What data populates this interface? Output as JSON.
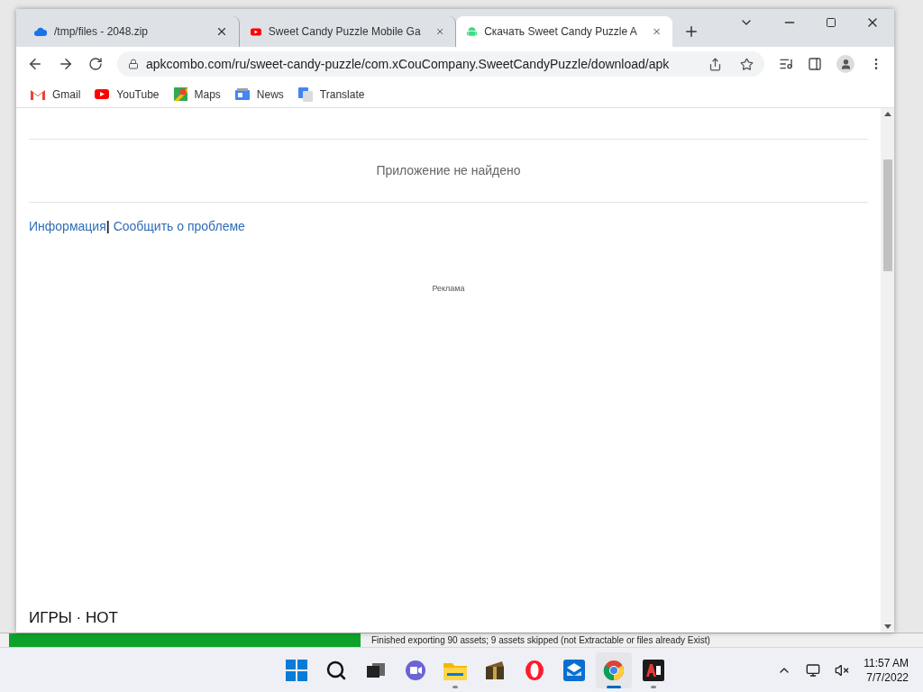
{
  "background_app": {
    "progress": {
      "level": 1
    },
    "status": "Finished exporting 90 assets; 9 assets skipped (not Extractable or files already Exist)"
  },
  "browser": {
    "tabs": [
      {
        "title": "/tmp/files - 2048.zip",
        "kind": "cloud",
        "selected": false
      },
      {
        "title": "Sweet Candy Puzzle Mobile Ga",
        "kind": "youtube",
        "selected": false
      },
      {
        "title": "Скачать Sweet Candy Puzzle A",
        "kind": "android",
        "selected": true
      }
    ],
    "address": "apkcombo.com/ru/sweet-candy-puzzle/com.xCouCompany.SweetCandyPuzzle/download/apk",
    "bookmarks": [
      {
        "label": "Gmail",
        "kind": "gmail"
      },
      {
        "label": "YouTube",
        "kind": "youtube"
      },
      {
        "label": "Maps",
        "kind": "maps"
      },
      {
        "label": "News",
        "kind": "news"
      },
      {
        "label": "Translate",
        "kind": "translate"
      }
    ]
  },
  "page": {
    "message": "Приложение не найдено",
    "links": [
      "Информация",
      "Сообщить о проблеме"
    ],
    "link_separator": "|",
    "ad_label": "Реклама",
    "section_heading": "ИГРЫ · HOT"
  },
  "taskbar": {
    "apps": [
      {
        "kind": "start",
        "running": false,
        "active": false
      },
      {
        "kind": "search",
        "running": false,
        "active": false
      },
      {
        "kind": "taskview",
        "running": false,
        "active": false
      },
      {
        "kind": "chat",
        "running": false,
        "active": false
      },
      {
        "kind": "explorer",
        "running": true,
        "active": false
      },
      {
        "kind": "archive",
        "running": false,
        "active": false
      },
      {
        "kind": "opera",
        "running": false,
        "active": false
      },
      {
        "kind": "mail",
        "running": false,
        "active": false
      },
      {
        "kind": "chrome",
        "running": true,
        "active": true
      },
      {
        "kind": "as",
        "running": true,
        "active": false
      }
    ],
    "time": "11:57 AM",
    "date": "7/7/2022"
  }
}
